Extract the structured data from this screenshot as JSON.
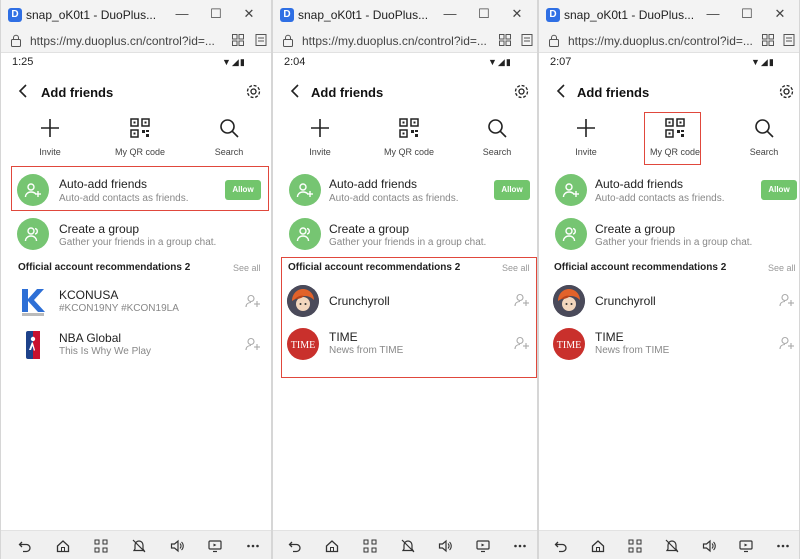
{
  "window": {
    "title": "snap_oK0t1 - DuoPlus...",
    "url": "https://my.duoplus.cn/control?id=...",
    "app_icon": "D"
  },
  "colors": {
    "green": "#76c572",
    "allow_bg": "#72c56c",
    "highlight": "#e0483c",
    "time_red": "#c9302c"
  },
  "panels": [
    {
      "time": "1:25",
      "highlight": "auto_add"
    },
    {
      "time": "2:04",
      "highlight": "official"
    },
    {
      "time": "2:07",
      "highlight": "my_qr"
    }
  ],
  "header": {
    "title": "Add friends"
  },
  "quick_actions": {
    "invite": "Invite",
    "my_qr": "My QR code",
    "search": "Search"
  },
  "auto_add": {
    "title": "Auto-add friends",
    "subtitle": "Auto-add contacts as friends.",
    "allow": "Allow"
  },
  "create_group": {
    "title": "Create a group",
    "subtitle": "Gather your friends in a group chat."
  },
  "official": {
    "title": "Official account recommendations 2",
    "see_all": "See all"
  },
  "accounts_p1": [
    {
      "name": "KCONUSA",
      "desc": "#KCON19NY #KCON19LA"
    },
    {
      "name": "NBA Global",
      "desc": "This Is Why We Play"
    }
  ],
  "accounts_p2": [
    {
      "name": "Crunchyroll",
      "desc": ""
    },
    {
      "name": "TIME",
      "desc": "News from TIME",
      "logo_text": "TIME"
    }
  ],
  "icons": [
    "back-icon",
    "gear-icon",
    "plus-icon",
    "qr-code-icon",
    "search-icon",
    "add-friend-icon",
    "group-icon",
    "lock-icon",
    "nav-back-icon",
    "nav-home-icon",
    "nav-apps-icon",
    "nav-mute-icon",
    "nav-volume-icon",
    "nav-screen-icon",
    "nav-more-icon"
  ]
}
